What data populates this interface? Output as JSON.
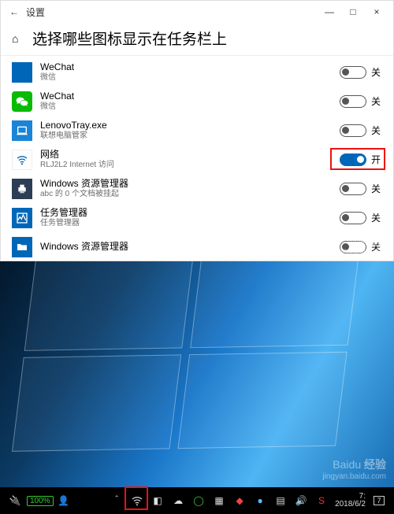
{
  "window": {
    "title": "设置",
    "min": "—",
    "max": "□",
    "close": "×",
    "back": "←"
  },
  "heading": {
    "home_glyph": "⌂",
    "title": "选择哪些图标显示在任务栏上"
  },
  "on_label": "开",
  "off_label": "关",
  "items": [
    {
      "title": "WeChat",
      "subtitle": "微信",
      "on": false,
      "icon": "wechat-blank"
    },
    {
      "title": "WeChat",
      "subtitle": "微信",
      "on": false,
      "icon": "wechat"
    },
    {
      "title": "LenovoTray.exe",
      "subtitle": "联想电脑管家",
      "on": false,
      "icon": "lenovo"
    },
    {
      "title": "网络",
      "subtitle": "RLJ2L2 Internet 访问",
      "on": true,
      "icon": "wifi",
      "highlight": true
    },
    {
      "title": "Windows 资源管理器",
      "subtitle": "abc 的 0 个文档被挂起",
      "on": false,
      "icon": "printer"
    },
    {
      "title": "任务管理器",
      "subtitle": "任务管理器",
      "on": false,
      "icon": "taskmgr"
    },
    {
      "title": "Windows 资源管理器",
      "subtitle": "",
      "on": false,
      "icon": "explorer"
    }
  ],
  "taskbar": {
    "battery": "100%",
    "date": "2018/6/2",
    "time": "7:",
    "notif_count": "7",
    "highlight_wifi": true
  },
  "watermark": {
    "brand_cn": "经验",
    "brand_en": "Baidu",
    "url": "jingyan.baidu.com"
  }
}
